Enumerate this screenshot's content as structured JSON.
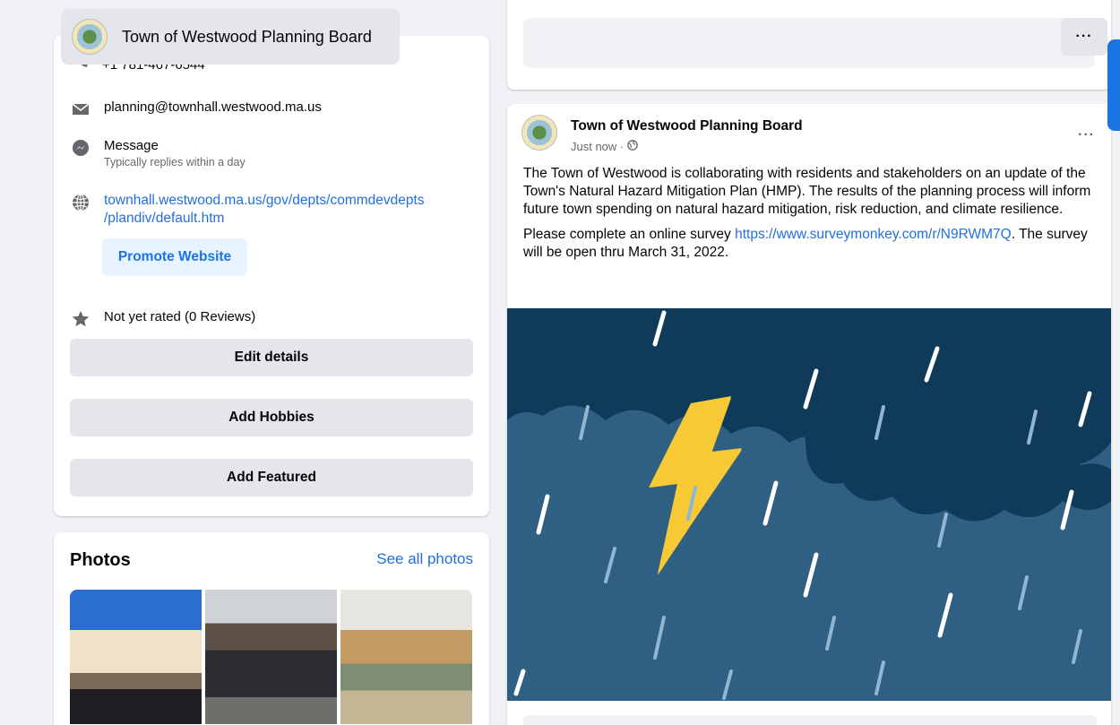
{
  "header": {
    "page_name": "Town of Westwood Planning Board",
    "more_label": "···"
  },
  "intro": {
    "phone_partial": "+1 781-467-6544",
    "email": "planning@townhall.westwood.ma.us",
    "message_label": "Message",
    "message_sub": "Typically replies within a day",
    "website_line1": "townhall.westwood.ma.us/gov/depts/commdevdepts",
    "website_line2": "/plandiv/default.htm",
    "promote_label": "Promote Website",
    "rating": "Not yet rated (0 Reviews)",
    "buttons": {
      "edit_details": "Edit details",
      "add_hobbies": "Add Hobbies",
      "add_featured": "Add Featured"
    }
  },
  "photos": {
    "title": "Photos",
    "see_all": "See all photos"
  },
  "post": {
    "author": "Town of Westwood Planning Board",
    "time": "Just now ·",
    "more_label": "···",
    "paragraph1": "The Town of Westwood is collaborating with residents and stakeholders on an update of the Town's Natural Hazard Mitigation Plan (HMP). The results of the planning process will inform future town spending on natural hazard mitigation, risk reduction, and climate resilience.",
    "paragraph2_before": "Please complete an online survey ",
    "survey_link": "https://www.surveymonkey.com/r/N9RWM7Q",
    "paragraph2_after": ". The survey will be open thru March 31, 2022."
  },
  "colors": {
    "link": "#216fdb",
    "accent": "#1b74e4",
    "storm_bg": "#2f5f82",
    "cloud": "#0f3a5a",
    "bolt": "#f6c935"
  },
  "icons": [
    "phone-icon",
    "mail-icon",
    "messenger-icon",
    "globe-icon",
    "star-icon",
    "more-icon",
    "public-globe-icon"
  ]
}
